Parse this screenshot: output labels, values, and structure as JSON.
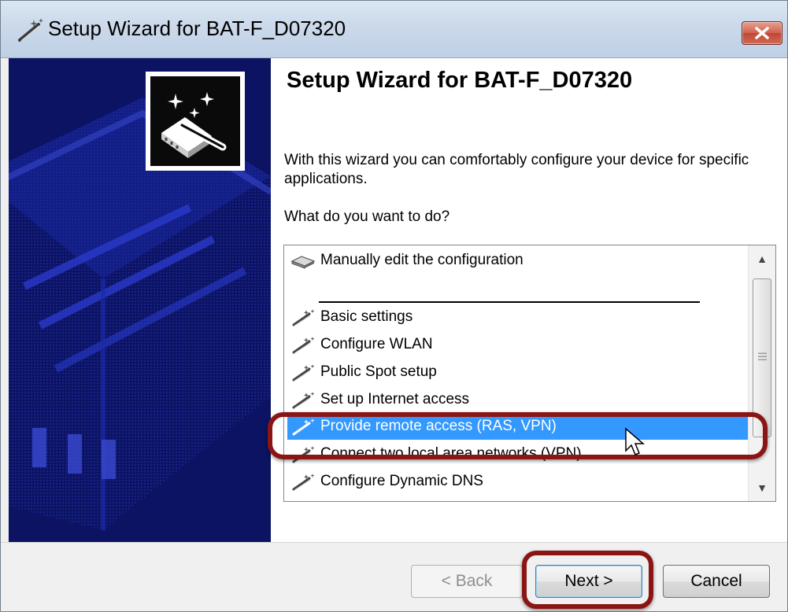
{
  "window": {
    "title": "Setup Wizard for BAT-F_D07320",
    "close_icon": "close-icon"
  },
  "sidebar": {
    "logo_icon": "wizard-wand-device-icon",
    "background_color": "#0c1362"
  },
  "content": {
    "heading": "Setup Wizard for BAT-F_D07320",
    "intro": "With this wizard you can comfortably configure your device for specific applications.",
    "question": "What do you want to do?"
  },
  "list": {
    "items": [
      {
        "label": "Manually edit the configuration",
        "icon": "device-icon"
      },
      {
        "label": "Basic settings",
        "icon": "wand-icon"
      },
      {
        "label": "Configure WLAN",
        "icon": "wand-icon"
      },
      {
        "label": "Public Spot setup",
        "icon": "wand-icon"
      },
      {
        "label": "Set up Internet access",
        "icon": "wand-icon"
      },
      {
        "label": "Provide remote access (RAS, VPN)",
        "icon": "wand-icon",
        "selected": true
      },
      {
        "label": "Connect two local area networks (VPN)",
        "icon": "wand-icon"
      },
      {
        "label": "Configure Dynamic DNS",
        "icon": "wand-icon"
      }
    ],
    "selection_color": "#3399ff"
  },
  "buttons": {
    "back": "< Back",
    "next": "Next >",
    "cancel": "Cancel"
  },
  "annotation_color": "#8b1414"
}
